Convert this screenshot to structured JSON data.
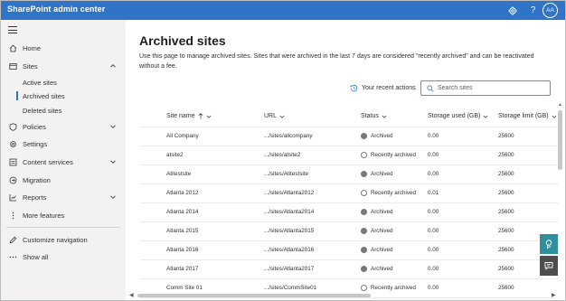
{
  "header": {
    "app_title": "SharePoint admin center",
    "avatar_initials": "AA",
    "icons": [
      "gear-icon",
      "help-icon"
    ],
    "bar_color": "#2f74c6"
  },
  "sidebar": {
    "menu_icon": "hamburger-icon",
    "items": [
      {
        "label": "Home",
        "icon": "home-icon"
      },
      {
        "label": "Sites",
        "icon": "sites-icon",
        "expanded": true
      },
      {
        "label": "Active sites"
      },
      {
        "label": "Archived sites",
        "selected": true
      },
      {
        "label": "Deleted sites"
      },
      {
        "label": "Policies",
        "icon": "policies-icon",
        "expandable": true
      },
      {
        "label": "Settings",
        "icon": "gear-icon"
      },
      {
        "label": "Content services",
        "icon": "content-services-icon",
        "expandable": true
      },
      {
        "label": "Migration",
        "icon": "migration-icon"
      },
      {
        "label": "Reports",
        "icon": "reports-icon",
        "expandable": true
      },
      {
        "label": "More features",
        "icon": "more-features-icon"
      },
      {
        "label": "Customize navigation",
        "icon": "pencil-icon"
      },
      {
        "label": "Show all",
        "icon": "ellipsis-icon"
      }
    ]
  },
  "main": {
    "title": "Archived sites",
    "description": "Use this page to manage archived sites. Sites that were archived in the last 7 days are considered \"recently archived\" and can be reactivated without a fee.",
    "recent_actions_label": "Your recent actions",
    "search": {
      "placeholder": "Search sites",
      "value": ""
    },
    "columns": [
      "Site name",
      "URL",
      "Status",
      "Storage used (GB)",
      "Storage limit (GB)"
    ],
    "sorted_column": "Site name",
    "sort_direction": "ascending",
    "rows": [
      {
        "name": "All Company",
        "url": ".../sites/allcompany",
        "status": "Archived",
        "used": "0.00",
        "limit": "25600"
      },
      {
        "name": "atsite2",
        "url": ".../sites/atsite2",
        "status": "Recently archived",
        "used": "0.00",
        "limit": "25600"
      },
      {
        "name": "Atitestsite",
        "url": ".../sites/Atitestsite",
        "status": "Archived",
        "used": "0.00",
        "limit": "25600"
      },
      {
        "name": "Atlanta 2012",
        "url": ".../sites/Atlanta2012",
        "status": "Recently archived",
        "used": "0.01",
        "limit": "25600"
      },
      {
        "name": "Atlanta 2014",
        "url": ".../sites/Atlanta2014",
        "status": "Archived",
        "used": "0.00",
        "limit": "25600"
      },
      {
        "name": "Atlanta 2015",
        "url": ".../sites/Atlanta2015",
        "status": "Archived",
        "used": "0.00",
        "limit": "25600"
      },
      {
        "name": "Atlanta 2016",
        "url": ".../sites/Atlanta2016",
        "status": "Archived",
        "used": "0.00",
        "limit": "25600"
      },
      {
        "name": "Atlanta 2017",
        "url": ".../sites/Atlanta2017",
        "status": "Archived",
        "used": "0.00",
        "limit": "25600"
      },
      {
        "name": "Comm Site 01",
        "url": ".../sites/CommSite01",
        "status": "Recently archived",
        "used": "0.00",
        "limit": "25600"
      }
    ]
  },
  "floating": {
    "help_icon": "chat-help-icon",
    "feedback_icon": "feedback-icon",
    "help_color": "#2f8f9d",
    "feedback_color": "#4d4d4d"
  }
}
